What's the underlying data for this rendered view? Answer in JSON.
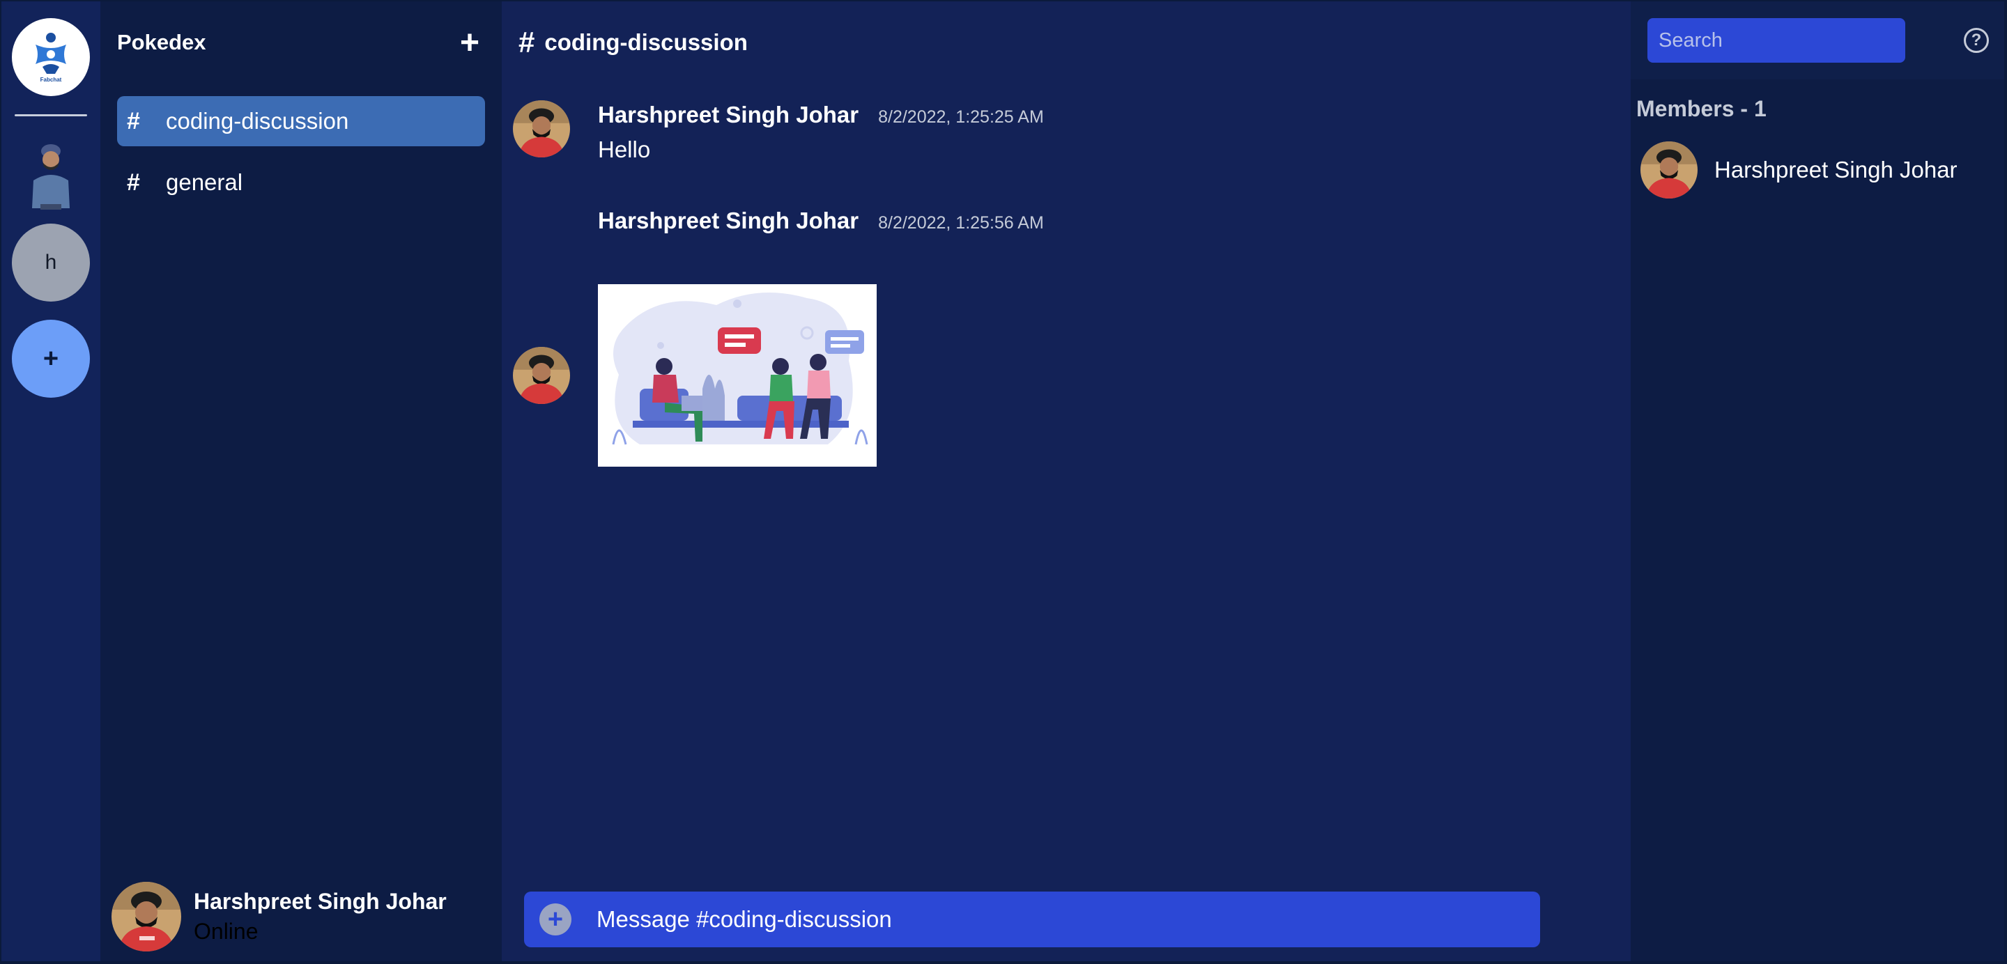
{
  "server": {
    "name": "Pokedex",
    "add_label": "+"
  },
  "rail": {
    "logo_text": "Fabchat",
    "items": [
      {
        "letter": "h"
      }
    ],
    "add_label": "+"
  },
  "channels": [
    {
      "hash": "#",
      "name": "coding-discussion",
      "active": true
    },
    {
      "hash": "#",
      "name": "general",
      "active": false
    }
  ],
  "current_user": {
    "name": "Harshpreet Singh Johar",
    "status": "Online"
  },
  "chat": {
    "hash": "#",
    "title": "coding-discussion",
    "messages": [
      {
        "author": "Harshpreet Singh Johar",
        "time": "8/2/2022, 1:25:25 AM",
        "text": "Hello"
      },
      {
        "author": "Harshpreet Singh Johar",
        "time": "8/2/2022, 1:25:56 AM",
        "text": ""
      }
    ],
    "composer_placeholder": "Message #coding-discussion",
    "composer_plus": "+"
  },
  "members": {
    "search_placeholder": "Search",
    "help": "?",
    "title": "Members - 1",
    "list": [
      {
        "name": "Harshpreet Singh Johar"
      }
    ]
  },
  "colors": {
    "accent": "#2c48d6",
    "active_channel": "#3c6cb4",
    "background": "#132257",
    "sidebar": "#0d1c44"
  }
}
